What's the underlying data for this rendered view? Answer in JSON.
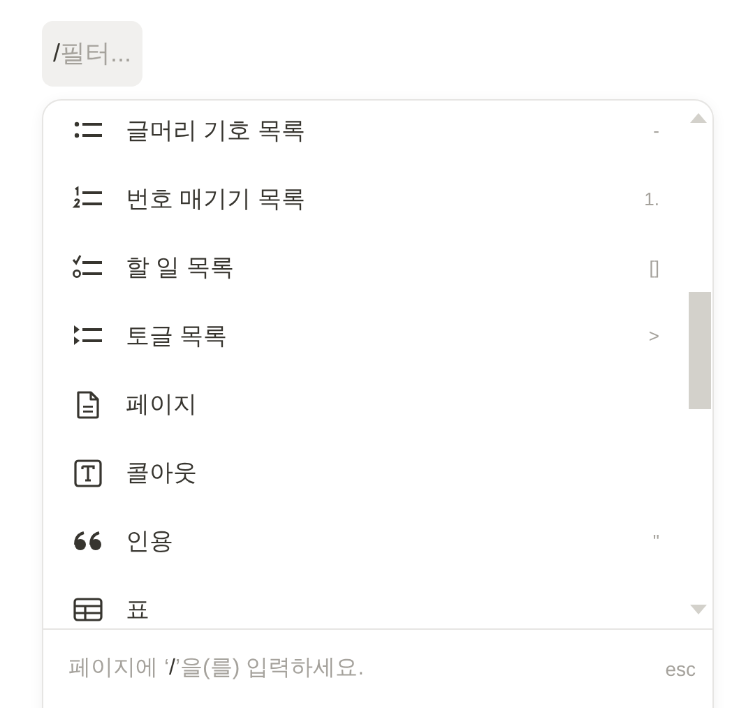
{
  "filter": {
    "value": "/",
    "placeholder": "필터..."
  },
  "menu": {
    "items": [
      {
        "kind": "bulleted",
        "label": "글머리 기호 목록",
        "shortcut": "-"
      },
      {
        "kind": "numbered",
        "label": "번호 매기기 목록",
        "shortcut": "1."
      },
      {
        "kind": "todo",
        "label": "할 일 목록",
        "shortcut": "[]"
      },
      {
        "kind": "toggle",
        "label": "토글 목록",
        "shortcut": ">"
      },
      {
        "kind": "page",
        "label": "페이지"
      },
      {
        "kind": "callout",
        "label": "콜아웃"
      },
      {
        "kind": "quote",
        "label": "인용",
        "shortcut": "\""
      },
      {
        "kind": "table",
        "label": "표"
      }
    ],
    "footer": {
      "hint_before": "페이지에 ‘",
      "hint_key": "/",
      "hint_after": "’을(를) 입력하세요.",
      "close_key": "esc"
    }
  }
}
